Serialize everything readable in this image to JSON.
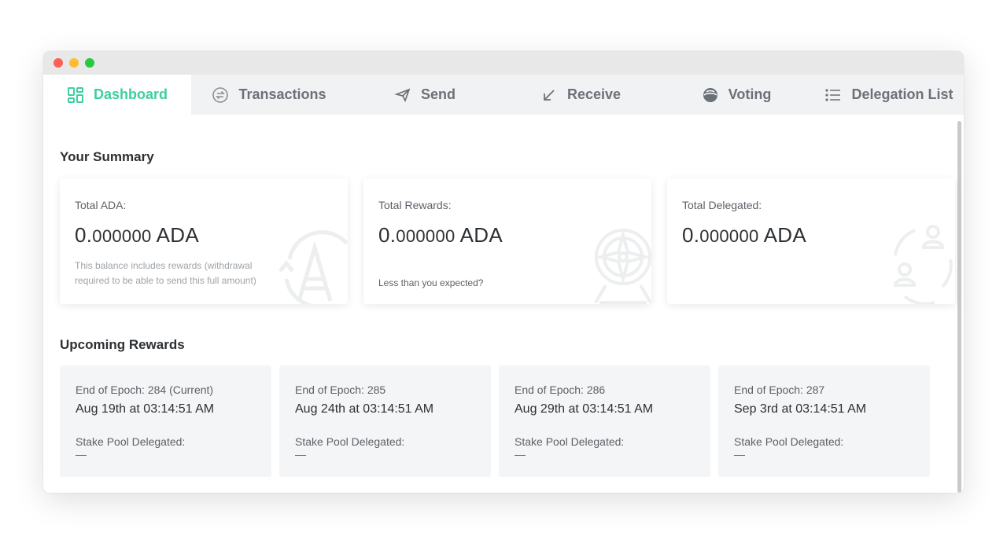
{
  "tabs": [
    {
      "label": "Dashboard",
      "icon": "dashboard-icon",
      "active": true
    },
    {
      "label": "Transactions",
      "icon": "transactions-icon"
    },
    {
      "label": "Send",
      "icon": "send-icon"
    },
    {
      "label": "Receive",
      "icon": "receive-icon"
    },
    {
      "label": "Voting",
      "icon": "voting-icon"
    },
    {
      "label": "Delegation List",
      "icon": "list-icon"
    }
  ],
  "colors": {
    "accent": "#3ccfa0",
    "tab_inactive": "#6b7178",
    "tabbar_bg": "#f1f2f4"
  },
  "summary": {
    "title": "Your Summary",
    "cards": [
      {
        "label": "Total ADA:",
        "amount_int": "0.",
        "amount_dec": "000000",
        "unit": " ADA",
        "note": "This balance includes rewards (withdrawal required to be able to send this full amount)",
        "icon": "ada-icon"
      },
      {
        "label": "Total Rewards:",
        "amount_int": "0.",
        "amount_dec": "000000",
        "unit": " ADA",
        "link": "Less than you expected?",
        "icon": "compass-icon"
      },
      {
        "label": "Total Delegated:",
        "amount_int": "0.",
        "amount_dec": "000000",
        "unit": " ADA",
        "icon": "users-icon"
      }
    ]
  },
  "rewards": {
    "title": "Upcoming Rewards",
    "cards": [
      {
        "epoch": "End of Epoch:  284 (Current)",
        "date": "Aug 19th at 03:14:51 AM",
        "pool_label": "Stake Pool Delegated:",
        "pool_value": "—"
      },
      {
        "epoch": "End of Epoch:  285",
        "date": "Aug 24th at 03:14:51 AM",
        "pool_label": "Stake Pool Delegated:",
        "pool_value": "—"
      },
      {
        "epoch": "End of Epoch:  286",
        "date": "Aug 29th at 03:14:51 AM",
        "pool_label": "Stake Pool Delegated:",
        "pool_value": "—"
      },
      {
        "epoch": "End of Epoch:  287",
        "date": "Sep 3rd at 03:14:51 AM",
        "pool_label": "Stake Pool Delegated:",
        "pool_value": "—"
      }
    ]
  }
}
